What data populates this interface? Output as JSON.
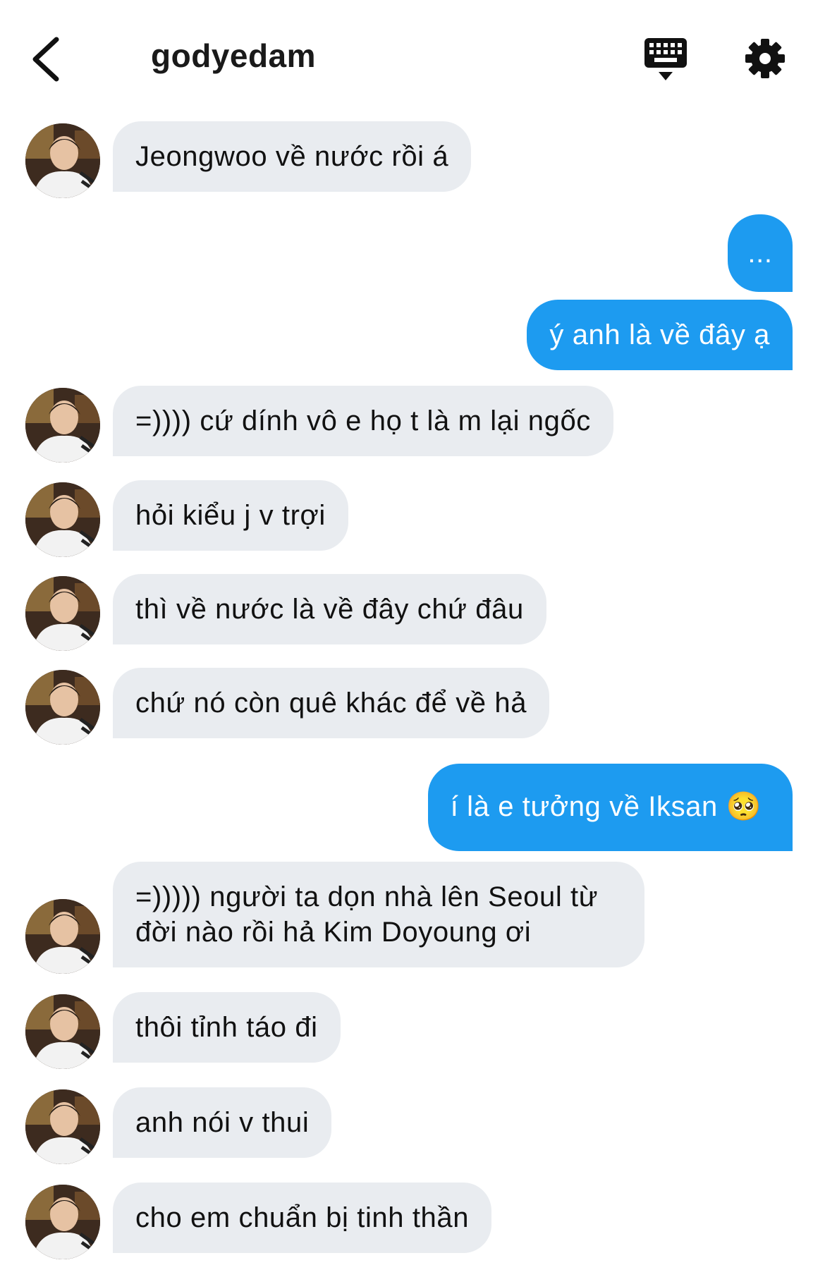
{
  "header": {
    "title": "godyedam"
  },
  "messages": [
    {
      "from": "them",
      "text": "Jeongwoo về nước rồi á"
    },
    {
      "from": "me",
      "text": "..."
    },
    {
      "from": "me",
      "text": "ý anh là về đây ạ"
    },
    {
      "from": "them",
      "text": "=)))) cứ dính vô e họ t là m lại ngốc"
    },
    {
      "from": "them",
      "text": "hỏi kiểu j v trợi"
    },
    {
      "from": "them",
      "text": "thì về nước là về đây chứ đâu"
    },
    {
      "from": "them",
      "text": "chứ nó còn quê khác để về hả"
    },
    {
      "from": "me",
      "text": "í là e tưởng về Iksan 🥺"
    },
    {
      "from": "them",
      "text": "=))))) người ta dọn nhà lên Seoul từ đời nào rồi hả Kim Doyoung ơi"
    },
    {
      "from": "them",
      "text": "thôi tỉnh táo đi"
    },
    {
      "from": "them",
      "text": "anh nói v thui"
    },
    {
      "from": "them",
      "text": "cho em chuẩn bị tinh thần"
    }
  ],
  "colors": {
    "incoming_bubble": "#e9ecf0",
    "outgoing_bubble": "#1d9bf0",
    "outgoing_text": "#ffffff"
  },
  "icons": {
    "back": "chevron-left-icon",
    "keyboard": "keyboard-icon",
    "settings": "gear-icon"
  }
}
